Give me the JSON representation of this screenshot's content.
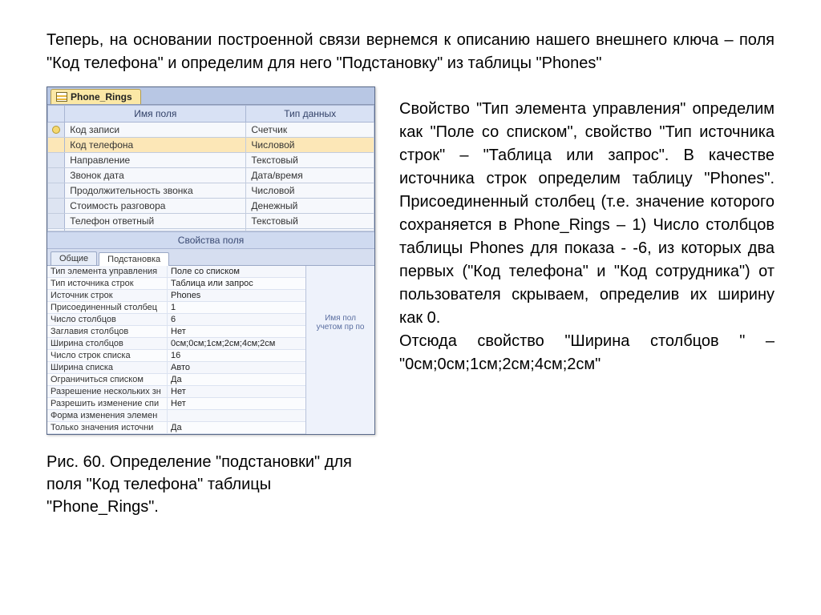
{
  "para_top": "Теперь, на основании построенной связи вернемся к описанию нашего внешнего ключа – поля \"Код телефона\" и определим для него \"Подстановку\" из таблицы \"Phones\"",
  "para_right_1": "Свойство \"Тип элемента управления\" определим как \"Поле со списком\", свойство \"Тип источника строк\" – \"Таблица или запрос\". В качестве источника строк определим таблицу \"Phones\". Присоединенный столбец (т.е. значение которого сохраняется в Phone_Rings – 1) Число столбцов таблицы Phones для показа - -6, из которых два первых (\"Код телефона\" и \"Код сотрудника\") от пользователя скрываем, определив их ширину как 0.",
  "para_right_2": "Отсюда свойство \"Ширина столбцов \" – \"0см;0см;1см;2см;4см;2см\"",
  "caption": "Рис. 60. Определение \"подстановки\" для поля \"Код телефона\" таблицы \"Phone_Rings\".",
  "access": {
    "tab_title": "Phone_Rings",
    "col_field": "Имя поля",
    "col_type": "Тип данных",
    "fields": [
      {
        "key": true,
        "sel": false,
        "name": "Код записи",
        "type": "Счетчик"
      },
      {
        "key": false,
        "sel": true,
        "name": "Код телефона",
        "type": "Числовой"
      },
      {
        "key": false,
        "sel": false,
        "name": "Направление",
        "type": "Текстовый"
      },
      {
        "key": false,
        "sel": false,
        "name": "Звонок дата",
        "type": "Дата/время"
      },
      {
        "key": false,
        "sel": false,
        "name": "Продолжительность звонка",
        "type": "Числовой"
      },
      {
        "key": false,
        "sel": false,
        "name": "Стоимость разговора",
        "type": "Денежный"
      },
      {
        "key": false,
        "sel": false,
        "name": "Телефон ответный",
        "type": "Текстовый"
      }
    ],
    "props_title": "Свойства поля",
    "tab_general": "Общие",
    "tab_lookup": "Подстановка",
    "help_text": "Имя пол учетом пр по",
    "props": [
      {
        "label": "Тип элемента управления",
        "value": "Поле со списком"
      },
      {
        "label": "Тип источника строк",
        "value": "Таблица или запрос"
      },
      {
        "label": "Источник строк",
        "value": "Phones"
      },
      {
        "label": "Присоединенный столбец",
        "value": "1"
      },
      {
        "label": "Число столбцов",
        "value": "6"
      },
      {
        "label": "Заглавия столбцов",
        "value": "Нет"
      },
      {
        "label": "Ширина столбцов",
        "value": "0см;0см;1см;2см;4см;2см"
      },
      {
        "label": "Число строк списка",
        "value": "16"
      },
      {
        "label": "Ширина списка",
        "value": "Авто"
      },
      {
        "label": "Ограничиться списком",
        "value": "Да"
      },
      {
        "label": "Разрешение нескольких зн",
        "value": "Нет"
      },
      {
        "label": "Разрешить изменение спи",
        "value": "Нет"
      },
      {
        "label": "Форма изменения элемен",
        "value": ""
      },
      {
        "label": "Только значения источни",
        "value": "Да"
      }
    ]
  }
}
